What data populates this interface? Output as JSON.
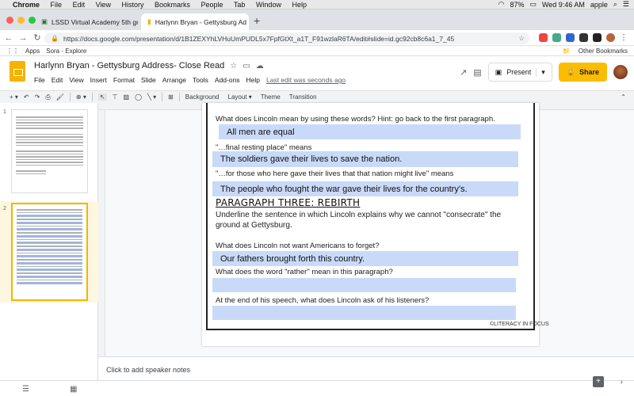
{
  "mac": {
    "menu": [
      "Chrome",
      "File",
      "Edit",
      "View",
      "History",
      "Bookmarks",
      "People",
      "Tab",
      "Window",
      "Help"
    ],
    "battery": "87%",
    "datetime": "Wed 9:46 AM",
    "user": "apple"
  },
  "tabs": [
    {
      "label": "LSSD Virtual Academy 5th gra"
    },
    {
      "label": "Harlynn Bryan - Gettysburg Ad"
    }
  ],
  "address": {
    "url": "https://docs.google.com/presentation/d/1B1ZEXYhLVHuUmPUDL5x7FpfGtXt_a1T_F91wzlaR6TA/edit#slide=id.gc92cb8c6a1_7_45"
  },
  "bookmarks": {
    "apps": "Apps",
    "sora": "Sora - Explore",
    "other": "Other Bookmarks"
  },
  "doc": {
    "title": "Harlynn Bryan - Gettysburg Address- Close Read",
    "last_edit": "Last edit was seconds ago",
    "menu": [
      "File",
      "Edit",
      "View",
      "Insert",
      "Format",
      "Slide",
      "Arrange",
      "Tools",
      "Add-ons",
      "Help"
    ],
    "present": "Present",
    "share": "Share"
  },
  "toolbar": {
    "background": "Background",
    "layout": "Layout",
    "theme": "Theme",
    "transition": "Transition"
  },
  "filmstrip": {
    "slide1": "1",
    "slide2": "2"
  },
  "slide": {
    "q1": "What does Lincoln mean by using these words? Hint: go back to the first paragraph.",
    "a1": "All men are equal",
    "q2": "\"…final resting place\" means",
    "a2": "The soldiers gave their lives to save the nation.",
    "q3": "\"…for those who here gave their lives that that nation might live\" means",
    "a3": "The people who fought the war gave their lives for the country's.",
    "heading": "PARAGRAPH THREE: REBIRTH",
    "instr1": "Underline the sentence in which Lincoln explains why we cannot \"consecrate\" the",
    "instr2": "ground at Gettysburg.",
    "q4": "What does Lincoln not want Americans to forget?",
    "a4": "Our fathers brought forth this country.",
    "q5": "What does the word \"rather\" mean in this paragraph?",
    "a5": "",
    "q6": "At the end of his speech, what does Lincoln ask of his listeners?",
    "a6": "",
    "logo": "©LITERACY IN FOCUS"
  },
  "notes": {
    "placeholder": "Click to add speaker notes"
  }
}
